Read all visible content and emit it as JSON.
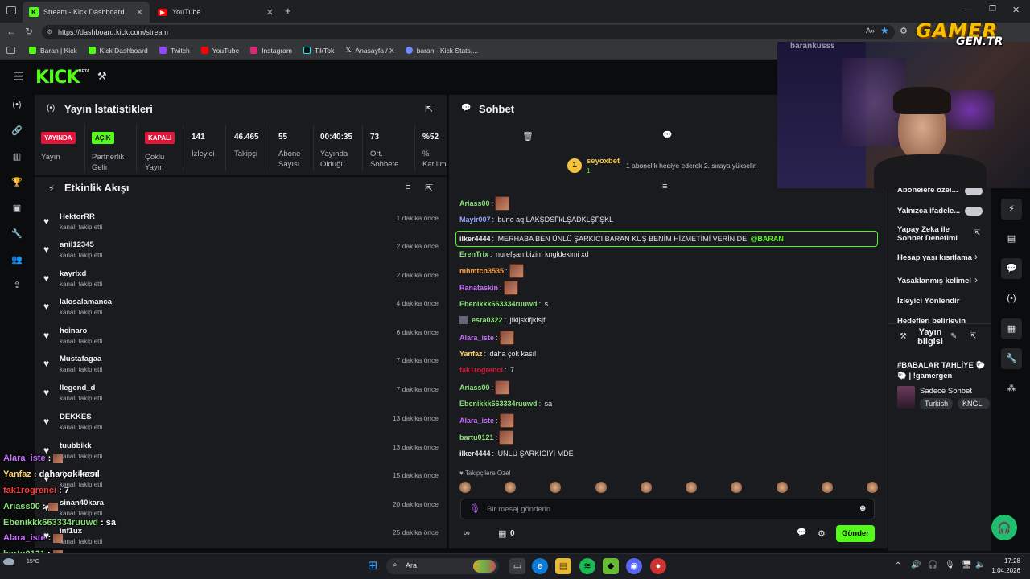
{
  "browser": {
    "tabs": [
      {
        "label": "Stream - Kick Dashboard"
      },
      {
        "label": "YouTube"
      }
    ],
    "url": "https://dashboard.kick.com/stream",
    "bookmarks": [
      "Baran | Kick",
      "Kick Dashboard",
      "Twitch",
      "YouTube",
      "Instagram",
      "TikTok",
      "Anasayfa / X",
      "baran - Kick Stats,..."
    ]
  },
  "kick": {
    "logo": "KICK",
    "logo_badge": "BETA",
    "stats": {
      "title": "Yayın İstatistikleri",
      "badges": [
        {
          "badge": "YAYINDA",
          "label": "Yayın",
          "color": "#e3143a"
        },
        {
          "badge": "AÇIK",
          "label": "Partnerlik Gelir",
          "color": "#53fc18"
        },
        {
          "badge": "KAPALI",
          "label": "Çoklu Yayın",
          "color": "#e3143a"
        }
      ],
      "values": [
        {
          "value": "141",
          "label": "İzleyici"
        },
        {
          "value": "46.465",
          "label": "Takipçi"
        },
        {
          "value": "55",
          "label": "Abone Sayısı"
        },
        {
          "value": "00:40:35",
          "label": "Yayında Olduğu"
        },
        {
          "value": "73",
          "label": "Ort. Sohbete"
        },
        {
          "value": "%52",
          "label": "% Katılım"
        }
      ]
    },
    "feed": {
      "title": "Etkinlik Akışı",
      "items": [
        {
          "name": "HektorRR",
          "sub": "kanalı takip etti",
          "time": "1 dakika önce"
        },
        {
          "name": "anil12345",
          "sub": "kanalı takip etti",
          "time": "2 dakika önce"
        },
        {
          "name": "kayrIxd",
          "sub": "kanalı takip etti",
          "time": "2 dakika önce"
        },
        {
          "name": "lalosalamanca",
          "sub": "kanalı takip etti",
          "time": "4 dakika önce"
        },
        {
          "name": "hcinaro",
          "sub": "kanalı takip etti",
          "time": "6 dakika önce"
        },
        {
          "name": "Mustafagaa",
          "sub": "kanalı takip etti",
          "time": "7 dakika önce"
        },
        {
          "name": "llegend_d",
          "sub": "kanalı takip etti",
          "time": "7 dakika önce"
        },
        {
          "name": "DEKKES",
          "sub": "kanalı takip etti",
          "time": "13 dakika önce"
        },
        {
          "name": "tuubbikk",
          "sub": "kanalı takip etti",
          "time": "13 dakika önce"
        },
        {
          "name": "rivenikuma",
          "sub": "kanalı takip etti",
          "time": "15 dakika önce"
        },
        {
          "name": "sinan40kara",
          "sub": "kanalı takip etti",
          "time": "20 dakika önce"
        },
        {
          "name": "inf1ux",
          "sub": "kanalı takip etti",
          "time": "25 dakika önce"
        }
      ]
    },
    "chat": {
      "title": "Sohbet",
      "pinned_user": "seyoxbet",
      "pinned_count": "1",
      "pinned_text": "1 abonelik hediye ederek 2. sıraya yükselin",
      "messages": [
        {
          "user": "Ariass00",
          "color": "#8ee07a",
          "text": "",
          "emote": true
        },
        {
          "user": "Mayir007",
          "color": "#9aa7ff",
          "text": " bune aq LAKŞDSFkLŞADKLŞFŞKL",
          "emote": false
        },
        {
          "user": "ilker4444",
          "color": "#f0f0f0",
          "text": " MERHABA BEN ÜNLÜ ŞARKICI BARAN KUŞ BENİM HİZMETİMİ VERİN DE ",
          "mention": "@BARAN",
          "emote": false,
          "highlight": true
        },
        {
          "user": "ErenTrix",
          "color": "#8ee07a",
          "text": " nurefşan bizim kngldekimi xd",
          "emote": false
        },
        {
          "user": "mhmtcn3535",
          "color": "#ff9f43",
          "text": "",
          "emote": true
        },
        {
          "user": "Ranataskin",
          "color": "#c86dff",
          "text": "",
          "emote": true
        },
        {
          "user": "Ebenikkk663334ruuwd",
          "color": "#8ee07a",
          "text": " s",
          "emote": false
        },
        {
          "user": "esra0322",
          "color": "#8ee07a",
          "text": " jfkljsklfjklsjf",
          "emote": false
        },
        {
          "user": "Alara_iste",
          "color": "#c86dff",
          "text": "",
          "emote": true
        },
        {
          "user": "Yanfaz",
          "color": "#ffd166",
          "text": " daha çok kasıl",
          "emote": false
        },
        {
          "user": "fak1rogrenci",
          "color": "#e3143a",
          "text": " 7",
          "emote": false
        },
        {
          "user": "Ariass00",
          "color": "#8ee07a",
          "text": "",
          "emote": true
        },
        {
          "user": "Ebenikkk663334ruuwd",
          "color": "#8ee07a",
          "text": " sa",
          "emote": false
        },
        {
          "user": "Alara_iste",
          "color": "#c86dff",
          "text": "",
          "emote": true
        },
        {
          "user": "bartu0121",
          "color": "#8ee07a",
          "text": "",
          "emote": true
        },
        {
          "user": "ilker4444",
          "color": "#f0f0f0",
          "text": " ÜNLÜ ŞARKICIYI MDE",
          "emote": false
        }
      ],
      "emotes_label": "Takipçilere Özel",
      "input_placeholder": "Bir mesaj gönderin",
      "count": "0",
      "send": "Gönder"
    },
    "settings": {
      "items": [
        "Abonelere özel...",
        "Yalnızca ifadele...",
        "Yapay Zeka ile Sohbet Denetimi",
        "Hesap yaşı kısıtlama",
        "Yasaklanmış kelimel",
        "İzleyici Yönlendir",
        "Hedefleri belirleyin"
      ]
    },
    "stream_info": {
      "title": "Yayın bilgisi",
      "stream_title": "#BABALAR TAHLİYE 🐑🐑 | !gamergen",
      "category": "Sadece Sohbet",
      "tags": [
        "Turkish",
        "KNGL"
      ]
    }
  },
  "webcam": {
    "name": "barankusss",
    "watermark_1": "GAMER",
    "watermark_2": "GEN.TR"
  },
  "overlay": [
    {
      "user": "Alara_iste",
      "text": "",
      "color": "#c86dff"
    },
    {
      "user": "Yanfaz",
      "text": "daha çok kasıl",
      "color": "#ffd166"
    },
    {
      "user": "fak1rogrenci",
      "text": "7",
      "color": "#ff3b3b"
    },
    {
      "user": "Ariass00",
      "text": "",
      "color": "#8ee07a"
    },
    {
      "user": "Ebenikkk663334ruuwd",
      "text": "sa",
      "color": "#8ee07a"
    },
    {
      "user": "Alara_iste",
      "text": "",
      "color": "#c86dff"
    },
    {
      "user": "bartu0121",
      "text": "",
      "color": "#8ee07a"
    },
    {
      "user": "ilker4444",
      "text": "ÜNLÜ ŞARKICIYI MDE",
      "color": "#ffffff"
    }
  ],
  "taskbar": {
    "search": "Ara",
    "temp": "15°C",
    "time": "17:28",
    "date": "1.04.2026"
  }
}
